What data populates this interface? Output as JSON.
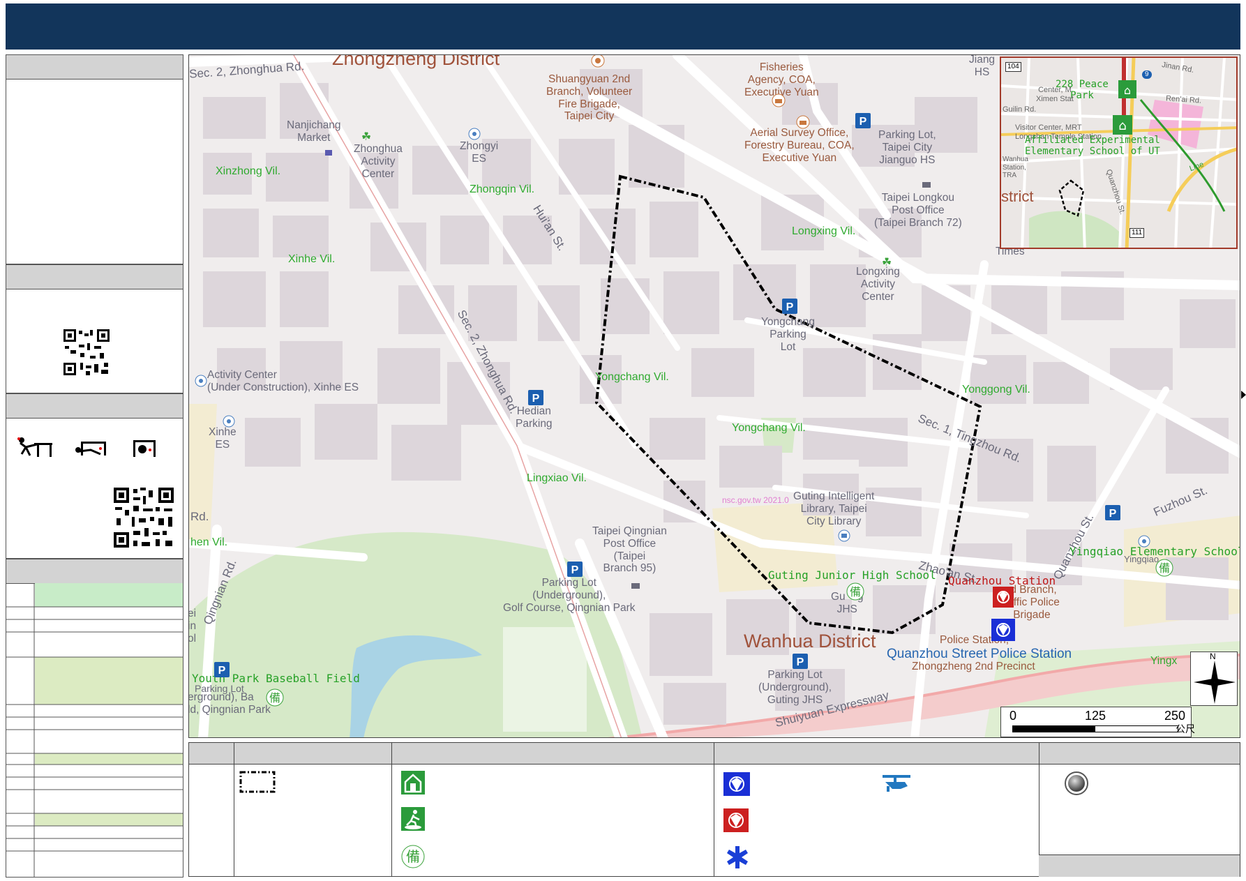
{
  "map": {
    "districts": [
      "Zhongzheng District",
      "Wanhua District",
      "strict"
    ],
    "villages": [
      "Xinzhong Vil.",
      "Zhongqin Vil.",
      "Xinhe Vil.",
      "Longxing Vil.",
      "Yongchang Vil.",
      "Yongchang Vil.",
      "Yonggong Vil.",
      "Lingxiao Vil.",
      "hen Vil."
    ],
    "roads": [
      "Sec. 2, Zhonghua Rd.",
      "Hui'an St.",
      "Sec. 2, Zhonghua Rd.",
      "Sec. 1, Tingzhou Rd.",
      "Zhao'an St.",
      "Quanzhou St.",
      "Fuzhou St.",
      "Qingnian Rd.",
      "Shuiyuan Expressway",
      "Rd."
    ],
    "pois": {
      "nanjichang": "Nanjichang\nMarket",
      "zhonghua_activity": "Zhonghua\nActivity\nCenter",
      "zhongyi": "Zhongyi\nES",
      "shuangyuan": "Shuangyuan 2nd\nBranch, Volunteer\nFire Brigade,\nTaipei City",
      "fisheries": "Fisheries\nAgency, COA,\nExecutive Yuan",
      "aerial": "Aerial Survey Office,\nForestry Bureau, COA,\nExecutive Yuan",
      "parking_jianguo": "Parking Lot,\nTaipei City\nJianguo HS",
      "jiang": "Jiang\nHS",
      "longkou_post": "Taipei Longkou\nPost Office\n(Taipei Branch 72)",
      "longxing_activity": "Longxing\nActivity\nCenter",
      "yongchang_parking": "Yongchang\nParking\nLot",
      "activity_xinhe": "Activity Center\n(Under Construction), Xinhe ES",
      "xinhe_es": "Xinhe\nES",
      "hedian": "Hedian\nParking",
      "qingnian_post": "Taipei Qingnian\nPost Office\n(Taipei\nBranch 95)",
      "parking_golf": "Parking Lot\n(Underground),\nGolf Course, Qingnian Park",
      "guting_library": "Guting Intelligent\nLibrary, Taipei\nCity Library",
      "guting_jhs": "Guting Junior High School",
      "gu_jhs": "Gu    g\nJHS",
      "parking_guting": "Parking Lot\n(Underground),\nGuting JHS",
      "quanzhou_station": "Quanzhou Station",
      "traffic_brigade": "rd Branch,\nraffic Police\nBrigade",
      "police_station_small": "Police Station,",
      "quanzhou_police": "Quanzhou Street Police Station",
      "zhongzheng_precinct": "Zhongzheng 2nd Precinct",
      "yingqiao": "Yingqiao Elementary School",
      "yingqiao_gray": "Yingqiao",
      "yingx": "Yingx",
      "youth_baseball": "Youth Park Baseball Field",
      "parking_lot_small": "Parking Lot",
      "baseball_under": "erground), Ba    all\nld, Qingnian Park",
      "times": "Times",
      "ei_col": "ei\nin\nol"
    },
    "watermark": "nsc.gov.tw 2021.0",
    "scale": {
      "labels": [
        "0",
        "125",
        "250"
      ],
      "unit": "公尺"
    },
    "north": "N"
  },
  "inset": {
    "labels": {
      "peace_park": "228 Peace\nPark",
      "ximen": "Center, M\nXimen Stat",
      "guilin": "Guilin Rd.",
      "visitor": "Visitor Center, MRT\nLongshan Temple Station",
      "affiliated": "Affiliated Experimental\nElementary School of UT",
      "wanhua": "Wanhua\nStation,\nTRA",
      "jinan": "Jinan Rd.",
      "renai": "Ren'ai Rd.",
      "line": "Line",
      "quanzhou": "Quanzhou St.",
      "strict": "strict",
      "badge_104": "104",
      "badge_111": "111",
      "badge_9": "9"
    }
  },
  "colors": {
    "header": "#12355b",
    "boundary": "#000000",
    "village_text": "#2faa2f",
    "shelter_green": "#2b9b3b",
    "police_blue": "#1a2fd6",
    "fire_red": "#cc2020",
    "parking_blue": "#1c5fb0",
    "inset_border": "#a23a2a"
  }
}
